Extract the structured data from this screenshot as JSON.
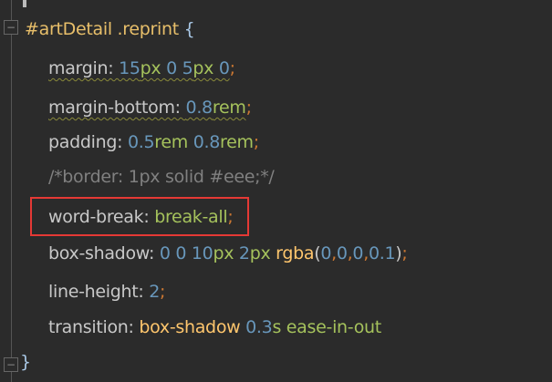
{
  "editor": {
    "lines": [
      {
        "tokens": [
          [
            "sel",
            "#artDetail .reprint "
          ],
          [
            "brace",
            "{"
          ]
        ]
      },
      {
        "warn": true,
        "tokens": [
          [
            "prop",
            "margin: "
          ],
          [
            "num",
            "15"
          ],
          [
            "unit",
            "px "
          ],
          [
            "num",
            "0 5"
          ],
          [
            "unit",
            "px "
          ],
          [
            "num",
            "0"
          ],
          [
            "semi",
            ";"
          ]
        ]
      },
      {
        "warn": true,
        "tokens": [
          [
            "prop",
            "margin-bottom: "
          ],
          [
            "num",
            "0.8"
          ],
          [
            "unit",
            "rem"
          ],
          [
            "semi",
            ";"
          ]
        ]
      },
      {
        "tokens": [
          [
            "prop",
            "padding: "
          ],
          [
            "num",
            "0.5"
          ],
          [
            "unit",
            "rem "
          ],
          [
            "num",
            "0.8"
          ],
          [
            "unit",
            "rem"
          ],
          [
            "semi",
            ";"
          ]
        ]
      },
      {
        "tokens": [
          [
            "cmt",
            "/*border: 1px solid #eee;*/"
          ]
        ]
      },
      {
        "highlighted": true,
        "tokens": [
          [
            "prop",
            "word-break: "
          ],
          [
            "val",
            "break-all"
          ],
          [
            "semi",
            ";"
          ]
        ]
      },
      {
        "tokens": [
          [
            "prop",
            "box-shadow: "
          ],
          [
            "num",
            "0 0 10"
          ],
          [
            "unit",
            "px "
          ],
          [
            "num",
            "2"
          ],
          [
            "unit",
            "px "
          ],
          [
            "fn",
            "rgba"
          ],
          [
            "prop",
            "("
          ],
          [
            "num",
            "0"
          ],
          [
            "semi",
            ","
          ],
          [
            "num",
            "0"
          ],
          [
            "semi",
            ","
          ],
          [
            "num",
            "0"
          ],
          [
            "semi",
            ","
          ],
          [
            "num",
            "0.1"
          ],
          [
            "prop",
            ")"
          ],
          [
            "semi",
            ";"
          ]
        ]
      },
      {
        "tokens": [
          [
            "prop",
            "line-height: "
          ],
          [
            "num",
            "2"
          ],
          [
            "semi",
            ";"
          ]
        ]
      },
      {
        "tokens": [
          [
            "prop",
            "transition: "
          ],
          [
            "kw",
            "box-shadow "
          ],
          [
            "num",
            "0.3"
          ],
          [
            "unit",
            "s "
          ],
          [
            "val",
            "ease-in-out"
          ]
        ]
      },
      {
        "tokens": [
          [
            "brace",
            "}"
          ]
        ]
      }
    ]
  },
  "colors": {
    "background": "#2b2b2b",
    "highlight_border": "#e53935"
  }
}
